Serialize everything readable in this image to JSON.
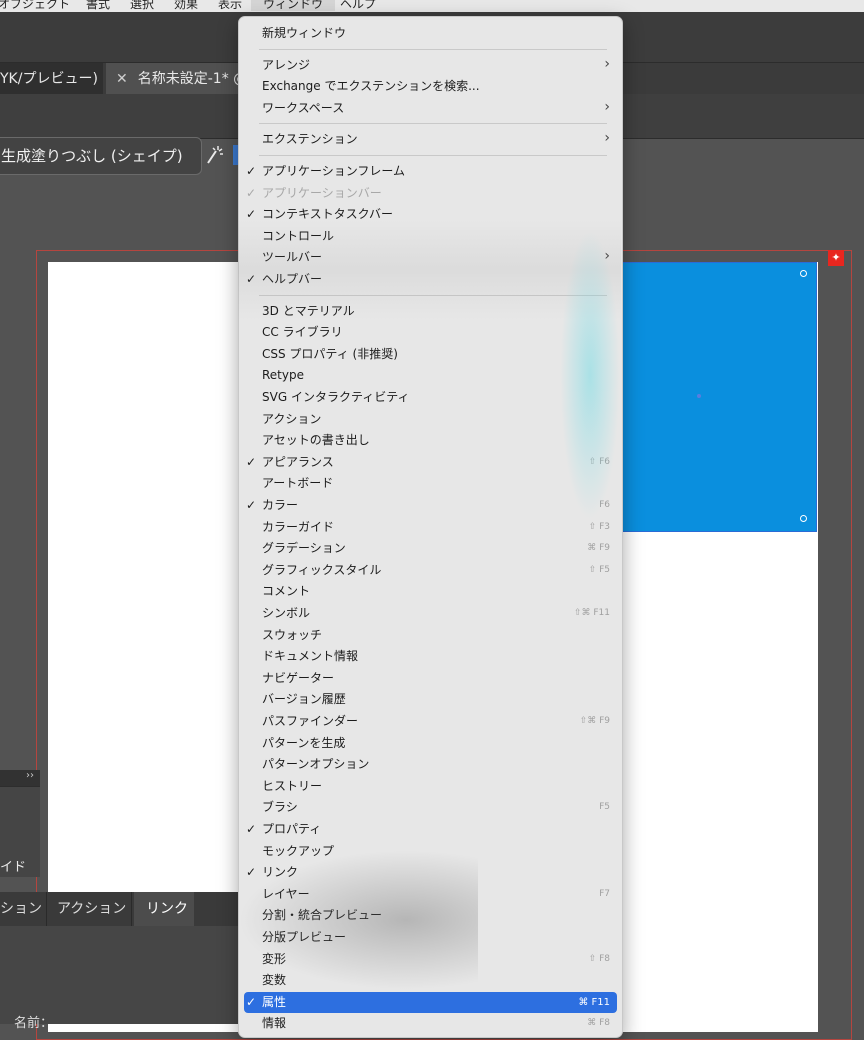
{
  "menubar": {
    "items": [
      "オブジェクト",
      "書式",
      "選択",
      "効果",
      "表示",
      "ウィンドウ",
      "ヘルプ"
    ],
    "active": "ウィンドウ"
  },
  "tabs": [
    {
      "label": "YK/プレビュー)"
    },
    {
      "close": "✕",
      "label": "名称未設定-1* @"
    }
  ],
  "control": {
    "generative_fill": "生成塗りつぶし (シェイプ)"
  },
  "left_panel": {
    "collapse": "››",
    "label": "イド"
  },
  "bottom_panel": {
    "tabs": [
      "ション",
      "アクション",
      "リンク"
    ],
    "name_label": "名前："
  },
  "menu": {
    "items": [
      {
        "label": "新規ウィンドウ"
      },
      {
        "label": "アレンジ",
        "submenu": true
      },
      {
        "label": "Exchange でエクステンションを検索..."
      },
      {
        "label": "ワークスペース",
        "submenu": true
      },
      {
        "label": "エクステンション",
        "submenu": true
      },
      {
        "label": "アプリケーションフレーム",
        "checked": true
      },
      {
        "label": "アプリケーションバー",
        "checked": true,
        "disabled": true
      },
      {
        "label": "コンテキストタスクバー",
        "checked": true
      },
      {
        "label": "コントロール"
      },
      {
        "label": "ツールバー",
        "submenu": true
      },
      {
        "label": "ヘルプバー",
        "checked": true
      },
      {
        "label": "3D とマテリアル"
      },
      {
        "label": "CC ライブラリ"
      },
      {
        "label": "CSS プロパティ (非推奨)"
      },
      {
        "label": "Retype"
      },
      {
        "label": "SVG インタラクティビティ"
      },
      {
        "label": "アクション"
      },
      {
        "label": "アセットの書き出し"
      },
      {
        "label": "アピアランス",
        "checked": true,
        "shortcut": "⇧ F6"
      },
      {
        "label": "アートボード"
      },
      {
        "label": "カラー",
        "checked": true,
        "shortcut": "F6"
      },
      {
        "label": "カラーガイド",
        "shortcut": "⇧ F3"
      },
      {
        "label": "グラデーション",
        "shortcut": "⌘ F9"
      },
      {
        "label": "グラフィックスタイル",
        "shortcut": "⇧ F5"
      },
      {
        "label": "コメント"
      },
      {
        "label": "シンボル",
        "shortcut": "⇧⌘ F11"
      },
      {
        "label": "スウォッチ"
      },
      {
        "label": "ドキュメント情報"
      },
      {
        "label": "ナビゲーター"
      },
      {
        "label": "バージョン履歴"
      },
      {
        "label": "パスファインダー",
        "shortcut": "⇧⌘ F9"
      },
      {
        "label": "パターンを生成"
      },
      {
        "label": "パターンオプション"
      },
      {
        "label": "ヒストリー"
      },
      {
        "label": "ブラシ",
        "shortcut": "F5"
      },
      {
        "label": "プロパティ",
        "checked": true
      },
      {
        "label": "モックアップ"
      },
      {
        "label": "リンク",
        "checked": true
      },
      {
        "label": "レイヤー",
        "shortcut": "F7"
      },
      {
        "label": "分割・統合プレビュー"
      },
      {
        "label": "分版プレビュー"
      },
      {
        "label": "変形",
        "shortcut": "⇧ F8"
      },
      {
        "label": "変数"
      },
      {
        "label": "属性",
        "checked": true,
        "shortcut": "⌘ F11",
        "highlighted": true
      },
      {
        "label": "情報",
        "shortcut": "⌘ F8"
      }
    ],
    "check_glyph": "✓",
    "arrow_glyph": "›"
  },
  "colors": {
    "highlight": "#2d6fe0",
    "selection_fill": "#0a8fde",
    "artboard_border": "#b5453f"
  }
}
